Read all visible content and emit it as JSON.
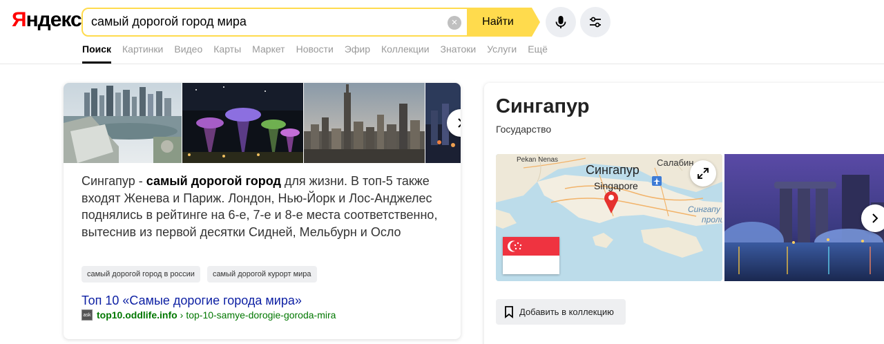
{
  "header": {
    "logo": "Яндекс",
    "search": {
      "value": "самый дорогой город мира",
      "placeholder": ""
    },
    "find_label": "Найти",
    "clear_icon": "×",
    "mic_icon": "microphone-icon",
    "settings_icon": "sliders-icon",
    "accent_color": "#ffdb4d",
    "tabs": [
      {
        "label": "Поиск",
        "active": true
      },
      {
        "label": "Картинки"
      },
      {
        "label": "Видео"
      },
      {
        "label": "Карты"
      },
      {
        "label": "Маркет"
      },
      {
        "label": "Новости"
      },
      {
        "label": "Эфир"
      },
      {
        "label": "Коллекции"
      },
      {
        "label": "Знатоки"
      },
      {
        "label": "Услуги"
      },
      {
        "label": "Ещё"
      }
    ]
  },
  "result": {
    "snippet_prefix": "Сингапур - ",
    "snippet_bold": "самый дорогой город",
    "snippet_rest": " для жизни. В топ-5 также входят Женева и Париж. Лондон, Нью-Йорк и Лос-Анджелес поднялись в рейтинге на 6-е, 7-е и 8-е места соответственно, вытеснив из первой десятки Сидней, Мельбурн и Осло",
    "chips": [
      "самый дорогой город в россии",
      "самый дорогой курорт мира"
    ],
    "title": "Топ 10 «Самые дорогие города мира»",
    "favicon_text": "ask",
    "url_domain": "top10.oddlife.info",
    "url_separator": "›",
    "url_path": "top-10-samye-dorogie-goroda-mira",
    "link_color": "#0c1fa3",
    "url_color": "#007700"
  },
  "entity": {
    "title": "Сингапур",
    "subtitle": "Государство",
    "map": {
      "city_ru": "Сингапур",
      "city_en": "Singapore",
      "label_pekan": "Pekan Nenas",
      "label_salabin": "Салабин",
      "label_strait": "Сингапу",
      "label_strait2": "проли"
    },
    "collect_label": "Добавить в коллекцию",
    "flag_colors": {
      "red": "#ef3340",
      "white": "#ffffff"
    }
  }
}
